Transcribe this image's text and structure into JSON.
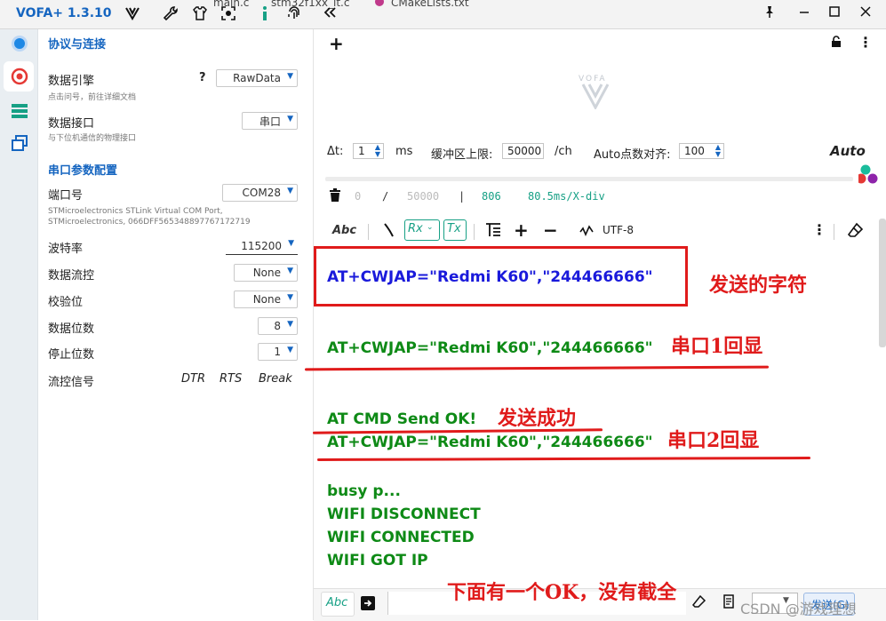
{
  "app": {
    "title": "VOFA+ 1.3.10",
    "tabs": [
      "main.c",
      "stm32f1xx_it.c",
      "CMakeLists.txt"
    ]
  },
  "colors": {
    "accent": "#1565c0",
    "terminal_blue": "#1a1adb",
    "terminal_green": "#0e8a16",
    "annotation_red": "#e01b1b"
  },
  "panel": {
    "section_protocol": "协议与连接",
    "engine_label": "数据引擎",
    "engine_help": "?",
    "engine_value": "RawData",
    "engine_sub": "点击问号，前往详细文档",
    "iface_label": "数据接口",
    "iface_value": "串口",
    "iface_sub": "与下位机通信的物理接口",
    "section_serial": "串口参数配置",
    "port_label": "端口号",
    "port_value": "COM28",
    "port_sub1": "STMicroelectronics STLink Virtual COM Port,",
    "port_sub2": "STMicroelectronics, 066DFF565348897767172719",
    "baud_label": "波特率",
    "baud_value": "115200",
    "flow_label": "数据流控",
    "flow_value": "None",
    "parity_label": "校验位",
    "parity_value": "None",
    "databits_label": "数据位数",
    "databits_value": "8",
    "stopbits_label": "停止位数",
    "stopbits_value": "1",
    "signal_label": "流控信号",
    "signal_dtr": "DTR",
    "signal_rts": "RTS",
    "signal_break": "Break"
  },
  "scope": {
    "logo": "VOFA",
    "dt_label": "Δt:",
    "dt_value": "1",
    "dt_unit": "ms",
    "buf_label": "缓冲区上限:",
    "buf_value": "50000",
    "buf_unit": "/ch",
    "auto_align_label": "Auto点数对齐:",
    "auto_align_value": "100",
    "auto_btn": "Auto",
    "stat_count": "0",
    "stat_sep1": "/",
    "stat_max": "50000",
    "stat_sep2": "|",
    "stat_pts": "806",
    "stat_div": "80.5ms/X-div"
  },
  "term_toolbar": {
    "abc": "Abc",
    "rx": "Rx",
    "tx": "Tx",
    "encoding": "UTF-8"
  },
  "terminal": {
    "line_sent": "AT+CWJAP=\"Redmi K60\",\"244466666\"",
    "line_echo1": "AT+CWJAP=\"Redmi K60\",\"244466666\"",
    "line_ok": "AT CMD Send OK!",
    "line_echo2": "AT+CWJAP=\"Redmi K60\",\"244466666\"",
    "line_busy": "busy p...",
    "line_disc": "WIFI DISCONNECT",
    "line_conn": "WIFI CONNECTED",
    "line_ip": "WIFI GOT IP"
  },
  "annotations": {
    "sent": "发送的字符",
    "echo1": "串口1回显",
    "success": "发送成功",
    "echo2": "串口2回显",
    "bottom": "下面有一个OK，没有截全"
  },
  "bottom_bar": {
    "abc": "Abc",
    "send_btn": "发送(G)",
    "watermark": "CSDN @游戏理想"
  }
}
